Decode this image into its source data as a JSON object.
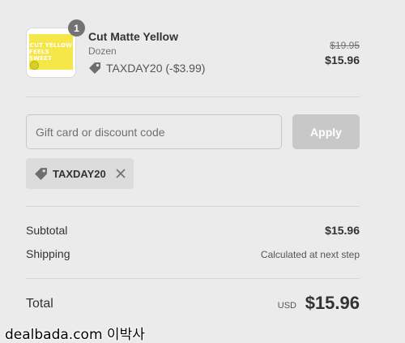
{
  "line_item": {
    "quantity": "1",
    "title": "Cut Matte Yellow",
    "variant": "Dozen",
    "discount": "TAXDAY20 (-$3.99)",
    "original_price": "$19.95",
    "price": "$15.96",
    "thumbnail_text": [
      "CUT YELLOW",
      "FEELS SWEET"
    ]
  },
  "discount_form": {
    "placeholder": "Gift card or discount code",
    "apply_label": "Apply"
  },
  "applied_code": {
    "code": "TAXDAY20",
    "tag_icon": "tag-icon",
    "remove_icon": "close-icon"
  },
  "summary": {
    "subtotal_label": "Subtotal",
    "subtotal_value": "$15.96",
    "shipping_label": "Shipping",
    "shipping_value": "Calculated at next step",
    "total_label": "Total",
    "total_currency": "USD",
    "total_value": "$15.96"
  },
  "watermark": "dealbada.com 이박사",
  "colors": {
    "background": "#ebebeb",
    "apply_button": "#c8c8c8",
    "badge": "#737373",
    "thumbnail_yellow": "#f5e64a"
  }
}
